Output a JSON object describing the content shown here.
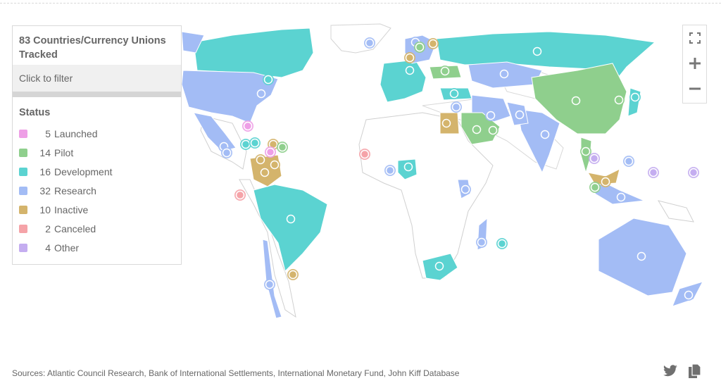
{
  "legend": {
    "title": "83 Countries/Currency Unions Tracked",
    "filter_hint": "Click to filter",
    "status_heading": "Status",
    "items": [
      {
        "count": "5",
        "label": "Launched",
        "color": "#ee9fe6"
      },
      {
        "count": "14",
        "label": "Pilot",
        "color": "#8fcf8d"
      },
      {
        "count": "16",
        "label": "Development",
        "color": "#5bd3d1"
      },
      {
        "count": "32",
        "label": "Research",
        "color": "#a3bcf5"
      },
      {
        "count": "10",
        "label": "Inactive",
        "color": "#d4b46c"
      },
      {
        "count": "2",
        "label": "Canceled",
        "color": "#f5a3a8"
      },
      {
        "count": "4",
        "label": "Other",
        "color": "#c4adf0"
      }
    ]
  },
  "map_controls": {
    "fullscreen_icon": "fullscreen-icon",
    "zoom_in_icon": "plus-icon",
    "zoom_out_icon": "minus-icon"
  },
  "footer": {
    "sources": "Sources: Atlantic Council Research, Bank of International Settlements, International Monetary Fund, John Kiff Database",
    "twitter_icon": "twitter-icon",
    "copy_icon": "copy-icon"
  },
  "markers": [
    {
      "region": "Canada",
      "status": "Development"
    },
    {
      "region": "United States",
      "status": "Research"
    },
    {
      "region": "Bahamas",
      "status": "Launched"
    },
    {
      "region": "Mexico",
      "status": "Research"
    },
    {
      "region": "Guatemala",
      "status": "Research"
    },
    {
      "region": "Jamaica",
      "status": "Development"
    },
    {
      "region": "Haiti",
      "status": "Development"
    },
    {
      "region": "Dominican Republic",
      "status": "Inactive"
    },
    {
      "region": "Eastern Caribbean",
      "status": "Launched"
    },
    {
      "region": "Trinidad",
      "status": "Pilot"
    },
    {
      "region": "Colombia",
      "status": "Inactive"
    },
    {
      "region": "Venezuela",
      "status": "Inactive"
    },
    {
      "region": "Ecuador",
      "status": "Inactive"
    },
    {
      "region": "Peru",
      "status": "Canceled"
    },
    {
      "region": "Brazil",
      "status": "Development"
    },
    {
      "region": "Chile",
      "status": "Research"
    },
    {
      "region": "Uruguay",
      "status": "Inactive"
    },
    {
      "region": "Iceland",
      "status": "Research"
    },
    {
      "region": "Norway",
      "status": "Research"
    },
    {
      "region": "Sweden",
      "status": "Pilot"
    },
    {
      "region": "Finland",
      "status": "Inactive"
    },
    {
      "region": "Denmark",
      "status": "Inactive"
    },
    {
      "region": "Russia",
      "status": "Development"
    },
    {
      "region": "Ukraine",
      "status": "Pilot"
    },
    {
      "region": "Euro Area",
      "status": "Development"
    },
    {
      "region": "Turkey",
      "status": "Development"
    },
    {
      "region": "Israel",
      "status": "Research"
    },
    {
      "region": "Egypt",
      "status": "Inactive"
    },
    {
      "region": "Saudi Arabia",
      "status": "Pilot"
    },
    {
      "region": "UAE",
      "status": "Pilot"
    },
    {
      "region": "Kazakhstan",
      "status": "Research"
    },
    {
      "region": "Iran",
      "status": "Research"
    },
    {
      "region": "Pakistan",
      "status": "Research"
    },
    {
      "region": "India",
      "status": "Research"
    },
    {
      "region": "China",
      "status": "Pilot"
    },
    {
      "region": "South Korea",
      "status": "Pilot"
    },
    {
      "region": "Japan",
      "status": "Development"
    },
    {
      "region": "Thailand",
      "status": "Pilot"
    },
    {
      "region": "Cambodia",
      "status": "Other"
    },
    {
      "region": "Philippines",
      "status": "Research"
    },
    {
      "region": "Malaysia",
      "status": "Inactive"
    },
    {
      "region": "Singapore",
      "status": "Pilot"
    },
    {
      "region": "Indonesia",
      "status": "Research"
    },
    {
      "region": "Australia",
      "status": "Research"
    },
    {
      "region": "New Zealand",
      "status": "Research"
    },
    {
      "region": "Senegal",
      "status": "Canceled"
    },
    {
      "region": "Nigeria",
      "status": "Development"
    },
    {
      "region": "Ghana",
      "status": "Research"
    },
    {
      "region": "Kenya",
      "status": "Research"
    },
    {
      "region": "Madagascar",
      "status": "Research"
    },
    {
      "region": "Mauritius",
      "status": "Development"
    },
    {
      "region": "South Africa",
      "status": "Development"
    },
    {
      "region": "Marshall Islands",
      "status": "Other"
    },
    {
      "region": "Micronesia",
      "status": "Other"
    }
  ]
}
